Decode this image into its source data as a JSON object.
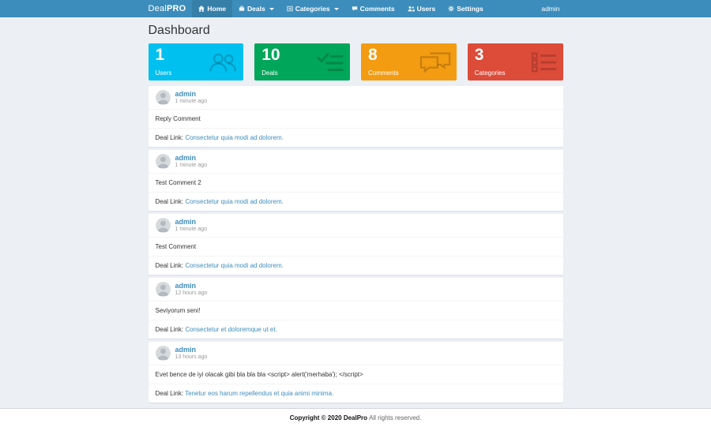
{
  "navbar": {
    "logo": {
      "light": "Deal",
      "bold": "PRO"
    },
    "items": [
      {
        "label": "Home"
      },
      {
        "label": "Deals"
      },
      {
        "label": "Categories"
      },
      {
        "label": "Comments"
      },
      {
        "label": "Users"
      },
      {
        "label": "Settings"
      }
    ],
    "user": "admin"
  },
  "page": {
    "title": "Dashboard"
  },
  "stats": [
    {
      "value": "1",
      "label": "Users",
      "color": "#00c0ef",
      "icon": "users-icon"
    },
    {
      "value": "10",
      "label": "Deals",
      "color": "#00a65a",
      "icon": "checklist-icon"
    },
    {
      "value": "8",
      "label": "Comments",
      "color": "#f39c12",
      "icon": "comments-icon"
    },
    {
      "value": "3",
      "label": "Categories",
      "color": "#dd4b39",
      "icon": "list-icon"
    }
  ],
  "comments": [
    {
      "author": "admin",
      "time": "1 minute ago",
      "body": "Reply Comment",
      "deal_label": "Deal Link:",
      "deal_link": "Consectetur quia modi ad dolorem."
    },
    {
      "author": "admin",
      "time": "1 minute ago",
      "body": "Test Comment 2",
      "deal_label": "Deal Link:",
      "deal_link": "Consectetur quia modi ad dolorem."
    },
    {
      "author": "admin",
      "time": "1 minute ago",
      "body": "Test Comment",
      "deal_label": "Deal Link:",
      "deal_link": "Consectetur quia modi ad dolorem."
    },
    {
      "author": "admin",
      "time": "12 hours ago",
      "body": "Seviyorum seni!",
      "deal_label": "Deal Link:",
      "deal_link": "Consectetur et doloremque ut et."
    },
    {
      "author": "admin",
      "time": "13 hours ago",
      "body": "Evet bence de iyi olacak gibi bla bla bla <script> alert('merhaba'); </script>",
      "deal_label": "Deal Link:",
      "deal_link": "Tenetur eos harum repellendus et quia animi minima."
    }
  ],
  "footer": {
    "bold": "Copyright © 2020 DealPro",
    "rest": "All rights reserved."
  },
  "colors": {
    "navbar": "#3c8dbc",
    "navbar_active": "#367fa9",
    "content_bg": "#ecf0f5",
    "link": "#3c8dbc"
  }
}
